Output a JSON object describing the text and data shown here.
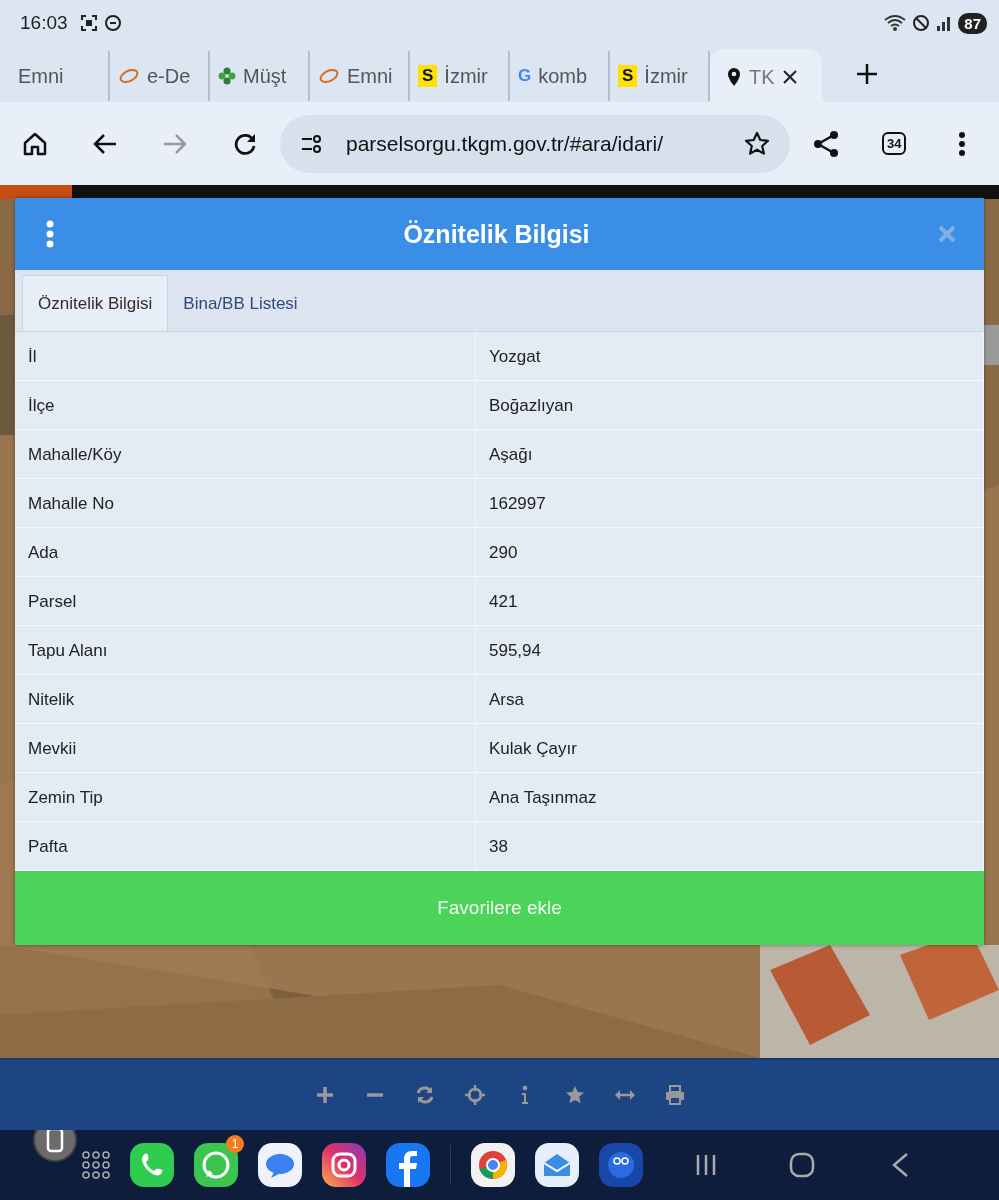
{
  "status_bar": {
    "time": "16:03",
    "battery": "87"
  },
  "browser_tabs": [
    {
      "label": "Emni",
      "kind": "faded",
      "selected": false
    },
    {
      "label": "e-De",
      "kind": "swoosh",
      "selected": false
    },
    {
      "label": "Müşt",
      "kind": "clover",
      "selected": false
    },
    {
      "label": "Emni",
      "kind": "swoosh",
      "selected": false
    },
    {
      "label": "İzmir",
      "kind": "letter",
      "letter": "S",
      "selected": false
    },
    {
      "label": "komb",
      "kind": "google",
      "letter": "G",
      "selected": false
    },
    {
      "label": "İzmir",
      "kind": "letter",
      "letter": "S",
      "selected": false
    },
    {
      "label": "TK",
      "kind": "pin",
      "selected": true
    }
  ],
  "address_bar": {
    "url": "parselsorgu.tkgm.gov.tr/#ara/idari/",
    "tab_count": "34"
  },
  "dialog": {
    "title": "Öznitelik Bilgisi",
    "tabs": [
      {
        "label": "Öznitelik Bilgisi",
        "selected": true
      },
      {
        "label": "Bina/BB Listesi",
        "selected": false
      }
    ],
    "rows": [
      {
        "label": "İl",
        "value": "Yozgat"
      },
      {
        "label": "İlçe",
        "value": "Boğazlıyan"
      },
      {
        "label": "Mahalle/Köy",
        "value": "Aşağı"
      },
      {
        "label": "Mahalle No",
        "value": "162997"
      },
      {
        "label": "Ada",
        "value": "290"
      },
      {
        "label": "Parsel",
        "value": "421"
      },
      {
        "label": "Tapu Alanı",
        "value": "595,94"
      },
      {
        "label": "Nitelik",
        "value": "Arsa"
      },
      {
        "label": "Mevkii",
        "value": "Kulak Çayır"
      },
      {
        "label": "Zemin Tip",
        "value": "Ana Taşınmaz"
      },
      {
        "label": "Pafta",
        "value": "38"
      }
    ],
    "action": "Favorilere ekle"
  },
  "map_toolbar": [
    {
      "kind": "plus"
    },
    {
      "kind": "minus"
    },
    {
      "kind": "refresh"
    },
    {
      "kind": "crosshair"
    },
    {
      "kind": "info"
    },
    {
      "kind": "star"
    },
    {
      "kind": "arrows"
    },
    {
      "kind": "printer"
    }
  ],
  "taskbar": {
    "apps": [
      {
        "kind": "phone"
      },
      {
        "kind": "whatsapp",
        "badge": "1"
      },
      {
        "kind": "messages"
      },
      {
        "kind": "instagram"
      },
      {
        "kind": "facebook"
      },
      {
        "kind": "chrome"
      },
      {
        "kind": "mail"
      },
      {
        "kind": "bank"
      }
    ]
  }
}
